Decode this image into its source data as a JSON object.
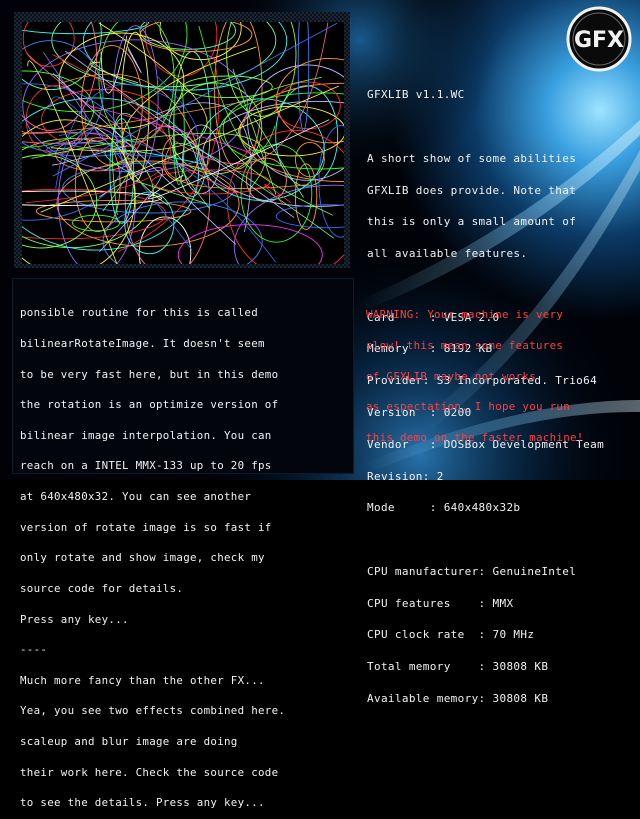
{
  "logo": {
    "text": "GFX",
    "icon": "gfx-logo-icon"
  },
  "title": "GFXLIB v1.1.WC",
  "intro": [
    "A short show of some abilities",
    "GFXLIB does provide. Note that",
    "this is only a small amount of",
    "all available features."
  ],
  "video_info": [
    "Card     : VESA 2.0",
    "Memory   : 8192 KB",
    "Provider: S3 Incorporated. Trio64",
    "Version  : 0200",
    "Vendor   : DOSBox Development Team",
    "Revision: 2",
    "Mode     : 640x480x32b"
  ],
  "cpu_info": [
    "CPU manufacturer: GenuineIntel",
    "CPU features    : MMX",
    "CPU clock rate  : 70 MHz",
    "Total memory    : 30808 KB",
    "Available memory: 30808 KB"
  ],
  "console_lines": [
    "ponsible routine for this is called",
    "bilinearRotateImage. It doesn't seem",
    "to be very fast here, but in this demo",
    "the rotation is an optimize version of",
    "bilinear image interpolation. You can",
    "reach on a INTEL MMX-133 up to 20 fps",
    "at 640x480x32. You can see another",
    "version of rotate image is so fast if",
    "only rotate and show image, check my",
    "source code for details.",
    "Press any key...",
    "----",
    "Much more fancy than the other FX...",
    "Yea, you see two effects combined here.",
    "scaleup and blur image are doing",
    "their work here. Check the source code",
    "to see the details. Press any key..."
  ],
  "warning_lines": [
    "WARNING: Your machine is very",
    "slow! this mean some features",
    "of GFXLIB maybe not works",
    "as espectation. I hope you run",
    "this demo on the faster machine!"
  ],
  "colors": {
    "text": "#f2f2f2",
    "warning": "#ff4040",
    "background_glow": "#3aa0e0"
  }
}
